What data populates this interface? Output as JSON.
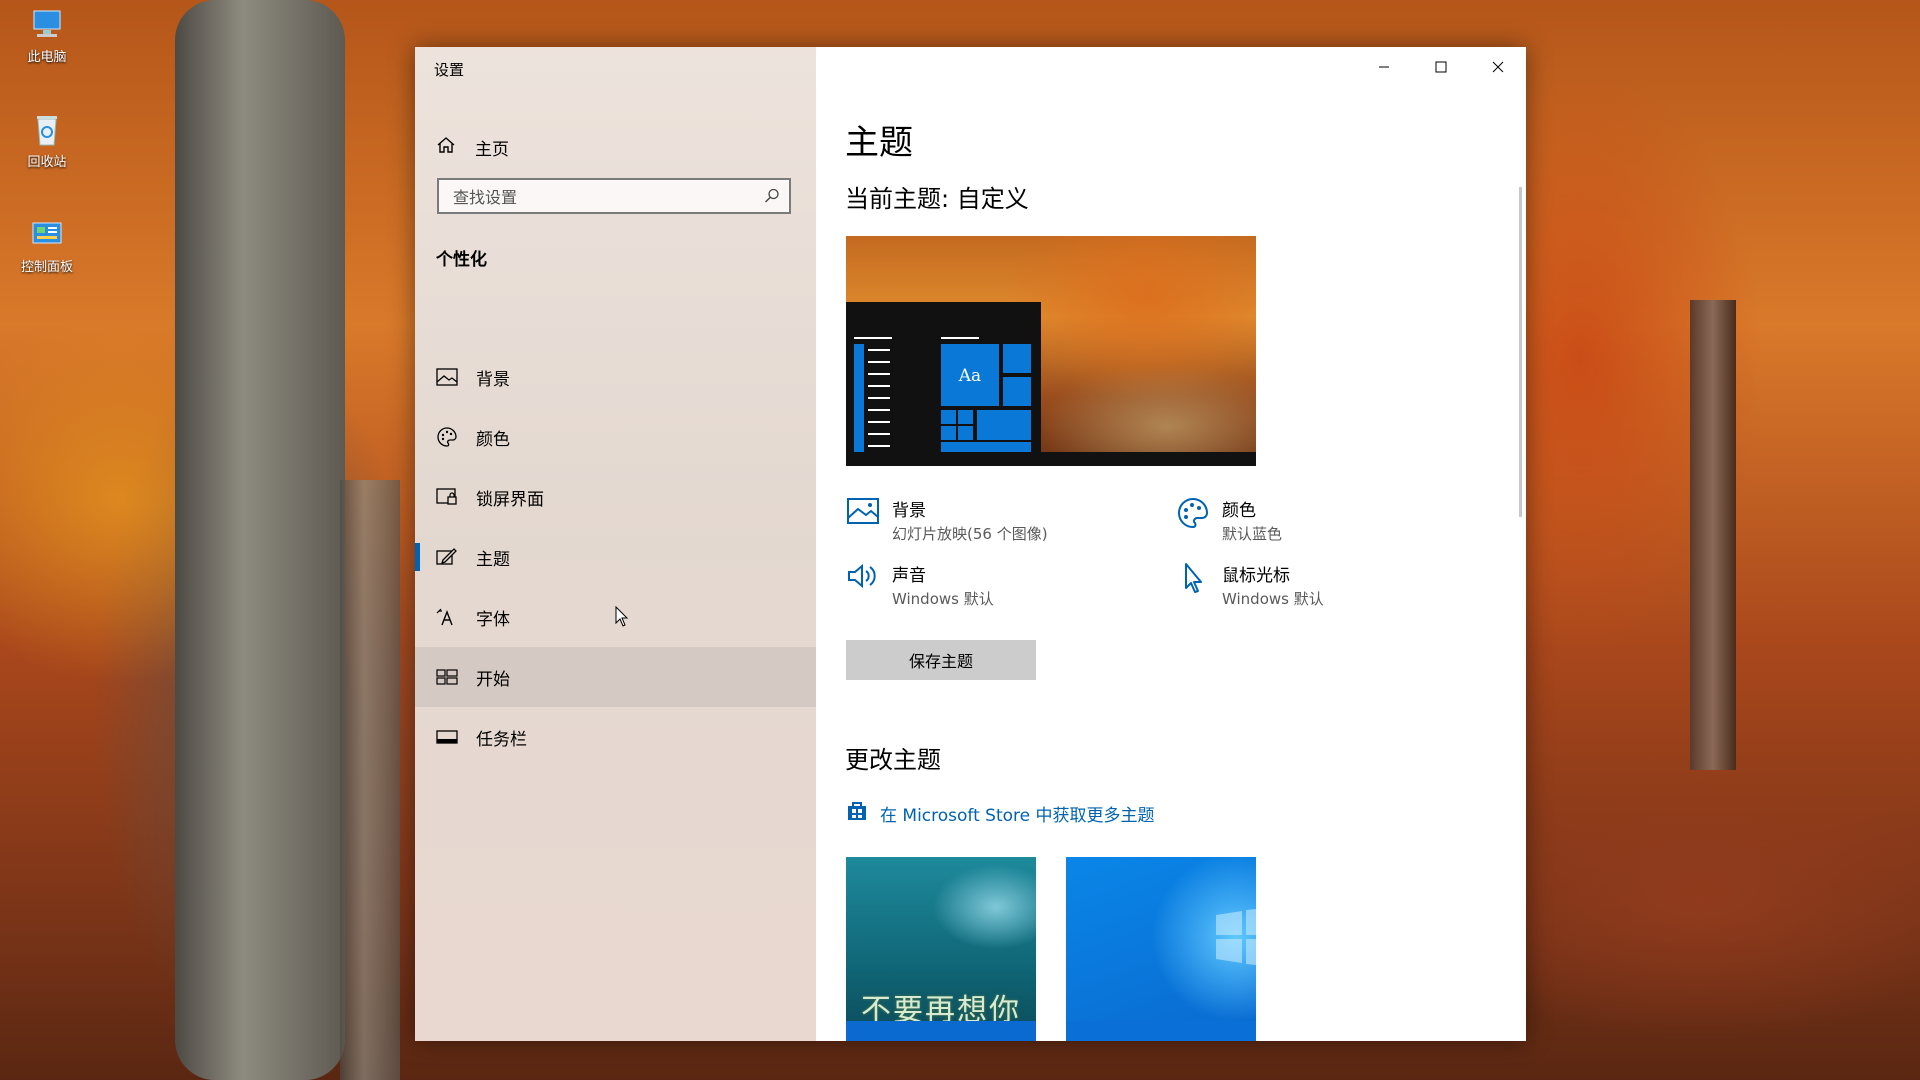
{
  "desktop": {
    "icons": [
      {
        "label": "此电脑",
        "icon": "computer-icon"
      },
      {
        "label": "回收站",
        "icon": "recycle-bin-icon"
      },
      {
        "label": "控制面板",
        "icon": "control-panel-icon"
      }
    ]
  },
  "window": {
    "title": "设置",
    "controls": [
      "minimize-icon",
      "maximize-icon",
      "close-icon"
    ]
  },
  "sidebar": {
    "home_label": "主页",
    "search_placeholder": "查找设置",
    "section_title": "个性化",
    "items": [
      {
        "label": "背景",
        "icon": "picture-icon"
      },
      {
        "label": "颜色",
        "icon": "palette-icon"
      },
      {
        "label": "锁屏界面",
        "icon": "lock-screen-icon"
      },
      {
        "label": "主题",
        "icon": "theme-icon",
        "active": true
      },
      {
        "label": "字体",
        "icon": "font-icon"
      },
      {
        "label": "开始",
        "icon": "start-icon",
        "hovered": true
      },
      {
        "label": "任务栏",
        "icon": "taskbar-icon"
      }
    ]
  },
  "main": {
    "title": "主题",
    "current_theme": "当前主题: 自定义",
    "preview_sample_text": "Aa",
    "properties": [
      {
        "title": "背景",
        "subtitle": "幻灯片放映(56 个图像)",
        "icon": "picture-icon"
      },
      {
        "title": "颜色",
        "subtitle": "默认蓝色",
        "icon": "palette-icon"
      },
      {
        "title": "声音",
        "subtitle": "Windows 默认",
        "icon": "speaker-icon"
      },
      {
        "title": "鼠标光标",
        "subtitle": "Windows 默认",
        "icon": "cursor-icon"
      }
    ],
    "save_button": "保存主题",
    "change_theme_title": "更改主题",
    "store_link": "在 Microsoft Store 中获取更多主题",
    "themes": [
      {
        "caption": "不要再想你"
      },
      {
        "caption": ""
      }
    ]
  },
  "colors": {
    "accent": "#0063b1",
    "tile_blue": "#0a78d7"
  }
}
